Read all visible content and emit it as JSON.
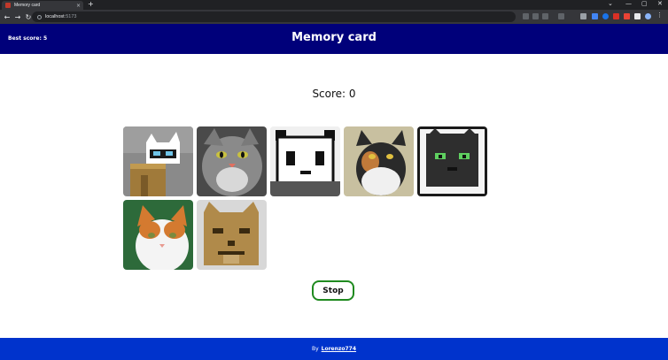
{
  "browser": {
    "tab_title": "Memory card",
    "tab_close": "×",
    "new_tab": "+",
    "url_host": "localhost",
    "url_port": ":5173",
    "nav_back": "←",
    "nav_forward": "→",
    "nav_reload": "↻",
    "win_min": "—",
    "win_max": "▢",
    "win_close": "✕",
    "chevron": "⌄"
  },
  "header": {
    "best_score_label": "Best score: 5",
    "title": "Memory card"
  },
  "game": {
    "score_label": "Score: 0",
    "cards": [
      {
        "name": "pixel-cat-on-block",
        "bg": "#8a8a8a"
      },
      {
        "name": "gray-tabby-cat",
        "bg": "#5a5a5a"
      },
      {
        "name": "pixel-panda-cat",
        "bg": "#e8e8e8"
      },
      {
        "name": "calico-cat",
        "bg": "#c8c0a0"
      },
      {
        "name": "pixel-black-cat",
        "bg": "#f2f2f2"
      },
      {
        "name": "orange-white-cat",
        "bg": "#2d6a3a"
      },
      {
        "name": "pixel-brown-cat",
        "bg": "#d8d8d8"
      }
    ],
    "stop_label": "Stop"
  },
  "footer": {
    "by_label": "By",
    "author": "Lorenzo774"
  },
  "colors": {
    "header_bg": "#00007a",
    "footer_bg": "#0033cc",
    "stop_border": "#1f8a1f"
  }
}
